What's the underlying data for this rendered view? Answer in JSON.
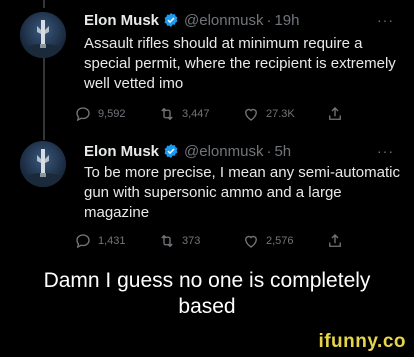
{
  "tweets": [
    {
      "author": "Elon Musk",
      "handle": "@elonmusk",
      "separator": "·",
      "time": "19h",
      "more": "···",
      "text": "Assault rifles should at minimum require a special permit, where the recipient is extremely well vetted imo",
      "replies": "9,592",
      "retweets": "3,447",
      "likes": "27.3K"
    },
    {
      "author": "Elon Musk",
      "handle": "@elonmusk",
      "separator": "·",
      "time": "5h",
      "more": "···",
      "text": "To be more precise, I mean any semi-automatic gun with supersonic ammo and a large magazine",
      "replies": "1,431",
      "retweets": "373",
      "likes": "2,576"
    }
  ],
  "caption": "Damn I guess no one is completely based",
  "watermark": "ifunny.co",
  "colors": {
    "background": "#000000",
    "text": "#e7e9ea",
    "muted": "#71767b",
    "verified": "#1d9bf0",
    "watermark": "#e6d44a"
  },
  "icons": [
    "verified-badge-icon",
    "reply-icon",
    "retweet-icon",
    "like-icon",
    "share-icon",
    "more-icon"
  ]
}
